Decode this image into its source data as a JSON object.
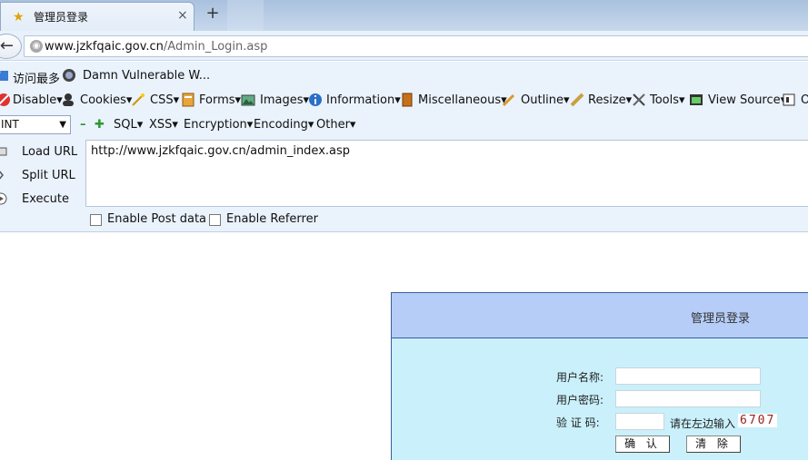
{
  "tab": {
    "title": "管理员登录",
    "close": "×",
    "new_tab": "+"
  },
  "nav": {
    "back": "←",
    "url_host": "www.jzkfqaic.gov.cn",
    "url_path": "/Admin_Login.asp"
  },
  "bookmarks": [
    {
      "label": "访问最多",
      "icon": "folder-icon"
    },
    {
      "label": "Damn Vulnerable W...",
      "icon": "dvwa-icon"
    }
  ],
  "webdev_toolbar": [
    {
      "label": "Disable",
      "icon": "disable-icon"
    },
    {
      "label": "Cookies",
      "icon": "cookies-icon"
    },
    {
      "label": "CSS",
      "icon": "css-wand-icon"
    },
    {
      "label": "Forms",
      "icon": "forms-icon"
    },
    {
      "label": "Images",
      "icon": "images-icon"
    },
    {
      "label": "Information",
      "icon": "information-icon"
    },
    {
      "label": "Miscellaneous",
      "icon": "miscellaneous-icon"
    },
    {
      "label": "Outline",
      "icon": "outline-pencil-icon"
    },
    {
      "label": "Resize",
      "icon": "resize-ruler-icon"
    },
    {
      "label": "Tools",
      "icon": "tools-icon"
    },
    {
      "label": "View Source",
      "icon": "view-source-icon"
    },
    {
      "label": "O",
      "icon": "options-icon"
    }
  ],
  "hackbar": {
    "select_value": "INT",
    "menus": [
      "SQL",
      "XSS",
      "Encryption",
      "Encoding",
      "Other"
    ],
    "load_url": "Load URL",
    "split_url": "Split URL",
    "execute": "Execute",
    "url_value": "http://www.jzkfqaic.gov.cn/admin_index.asp",
    "enable_post": "Enable Post data",
    "enable_referrer": "Enable Referrer"
  },
  "login": {
    "title": "管理员登录",
    "username_label": "用户名称:",
    "password_label": "用户密码:",
    "captcha_label": "验 证 码:",
    "captcha_hint": "请在左边输入",
    "captcha_value": "6707",
    "confirm_button": "确 认",
    "clear_button": "清 除"
  },
  "colors": {
    "panel_bg": "#c9f0fb",
    "panel_head": "#b6cdf7",
    "panel_border": "#3a5f9b",
    "toolbar_bg": "#eaf2fc"
  }
}
